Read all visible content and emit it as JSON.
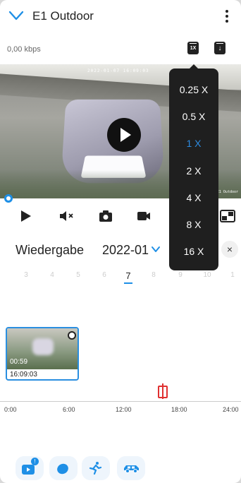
{
  "header": {
    "title": "E1 Outdoor"
  },
  "status": {
    "bitrate": "0,00 kbps"
  },
  "toolbar": {
    "speed_badge": "1X",
    "download_glyph": "↓"
  },
  "video": {
    "osd_timestamp": "2022-01-07 16:09:03",
    "osd_camera": "E1 Outdoor"
  },
  "playback": {
    "title": "Wiedergabe",
    "month": "2022-01",
    "close_glyph": "×",
    "days": [
      "3",
      "4",
      "5",
      "6",
      "7",
      "8",
      "9",
      "10",
      "1"
    ],
    "selected_day": "7"
  },
  "clip": {
    "duration": "00:59",
    "start_time": "16:09:03"
  },
  "timeline": {
    "labels": [
      "0:00",
      "6:00",
      "12:00",
      "18:00",
      "24:00"
    ]
  },
  "filters": {
    "badge": "!"
  },
  "speed_menu": {
    "items": [
      "0.25 X",
      "0.5 X",
      "1 X",
      "2 X",
      "4 X",
      "8 X",
      "16 X"
    ],
    "selected": "1 X"
  },
  "colors": {
    "accent": "#1e8fe6",
    "marker": "#e03030",
    "menu_bg": "#1f1f1f"
  }
}
